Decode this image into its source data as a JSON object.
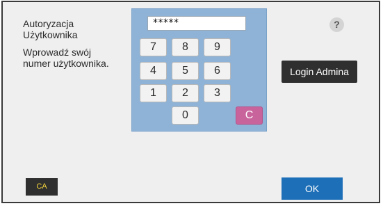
{
  "auth": {
    "title": "Autoryzacja Użytkownika",
    "description": "Wprowadź swój numer użytkownika."
  },
  "pin": {
    "value": "*****"
  },
  "keypad": {
    "keys": [
      "7",
      "8",
      "9",
      "4",
      "5",
      "6",
      "1",
      "2",
      "3",
      "0"
    ],
    "clear": "C"
  },
  "help": {
    "label": "?"
  },
  "buttons": {
    "admin_login": "Login Admina",
    "clear_all": "CA",
    "ok": "OK"
  },
  "colors": {
    "keypad_bg": "#8fb3d6",
    "clear_key": "#c9639c",
    "ok_button": "#1d6fb8",
    "ca_label": "#f4d23a"
  }
}
